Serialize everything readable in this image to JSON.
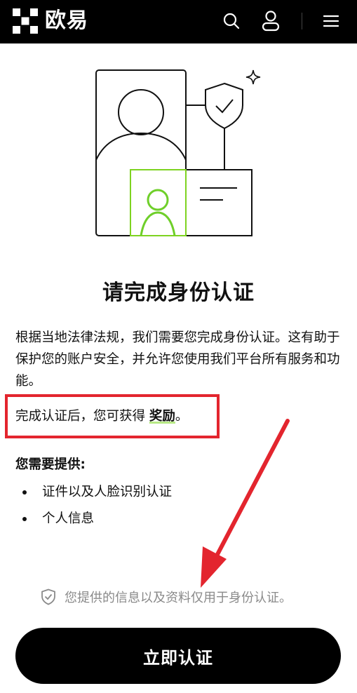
{
  "header": {
    "brand": "欧易",
    "icons": [
      "logo-icon",
      "search-icon",
      "user-icon",
      "menu-icon"
    ]
  },
  "page": {
    "title": "请完成身份认证",
    "description": "根据当地法律法规，我们需要您完成身份认证。这有助于保护您的账户安全，并允许您使用我们平台所有服务和功能。",
    "reward_prefix": "完成认证后，您可获得 ",
    "reward_word": "奖励",
    "reward_suffix": "。",
    "requirements_title": "您需要提供:",
    "requirements": [
      "证件以及人脸识别认证",
      "个人信息"
    ],
    "privacy_notice": "您提供的信息以及资料仅用于身份认证。",
    "cta_label": "立即认证"
  },
  "colors": {
    "topbar": "#000000",
    "accent_green": "#b8e986",
    "highlight_red": "#e3252e",
    "cta_bg": "#000000",
    "muted_text": "#8a8a8a"
  }
}
